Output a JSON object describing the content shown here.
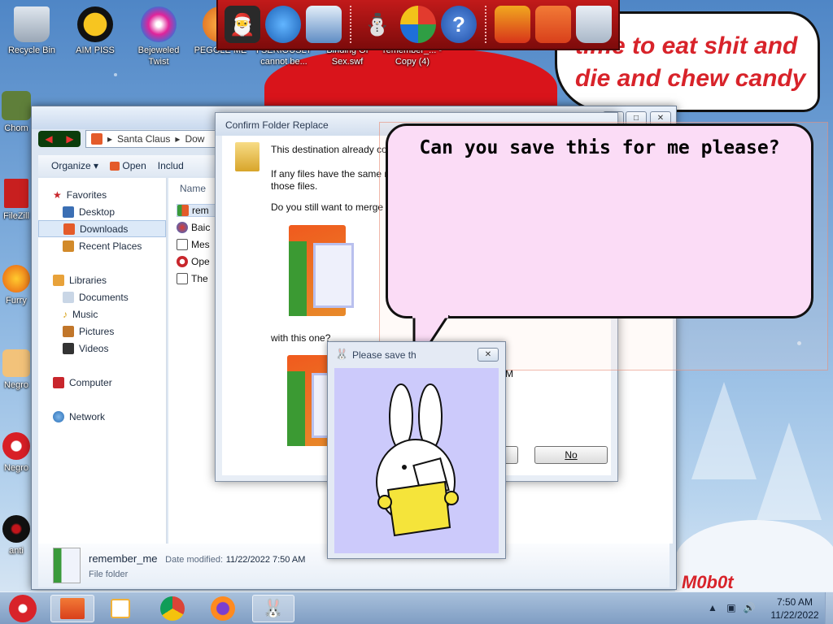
{
  "desktop": {
    "icons": [
      {
        "label": "Recycle Bin",
        "icon": "recycle-bin-icon"
      },
      {
        "label": "AIM PISS",
        "icon": "aim-icon"
      },
      {
        "label": "Bejeweled Twist",
        "icon": "bejeweled-icon"
      },
      {
        "label": "PEGGLE ME",
        "icon": "peggle-icon"
      },
      {
        "label": "I SERIOUSLY cannot be...",
        "icon": "globe-icon"
      },
      {
        "label": "Binding Of Sex.swf",
        "icon": "swf-icon"
      },
      {
        "label": "remember_... - Copy (4)",
        "icon": "folder-icon"
      },
      {
        "label": "Chom",
        "icon": "chrome-icon"
      },
      {
        "label": "FileZill",
        "icon": "filezilla-icon"
      },
      {
        "label": "Furry",
        "icon": "firefox-icon"
      },
      {
        "label": "Negro",
        "icon": "house-icon"
      },
      {
        "label": "Negro",
        "icon": "app-icon"
      },
      {
        "label": "anti",
        "icon": "app-dark-icon"
      }
    ],
    "rant_text": "time to eat shit and die and chew candy canes",
    "watermark": "M0b0t"
  },
  "explorer": {
    "breadcrumb": [
      "Santa Claus",
      "Dow"
    ],
    "toolbar": {
      "organize": "Organize",
      "open": "Open",
      "include": "Includ"
    },
    "nav": {
      "favorites": "Favorites",
      "desktop": "Desktop",
      "downloads": "Downloads",
      "recent": "Recent Places",
      "libraries": "Libraries",
      "documents": "Documents",
      "music": "Music",
      "pictures": "Pictures",
      "videos": "Videos",
      "computer": "Computer",
      "network": "Network"
    },
    "column_name": "Name",
    "files": [
      "rem",
      "Baic",
      "Mes",
      "Ope",
      "The"
    ],
    "details": {
      "name": "remember_me",
      "modified_label": "Date modified:",
      "modified_value": "11/22/2022 7:50 AM",
      "type": "File folder"
    }
  },
  "confirm": {
    "title": "Confirm Folder Replace",
    "line1": "This destination already co",
    "line2": "If any files have the same n",
    "line3": "those files.",
    "question": "Do you still want to merge",
    "with_this": "with this one?",
    "time_frag": "M",
    "no_label": "No"
  },
  "balloon": {
    "text": "Can you save this for me please?"
  },
  "bunny_dialog": {
    "title": "Please save th"
  },
  "taskbar": {
    "time": "7:50 AM",
    "date": "11/22/2022"
  }
}
